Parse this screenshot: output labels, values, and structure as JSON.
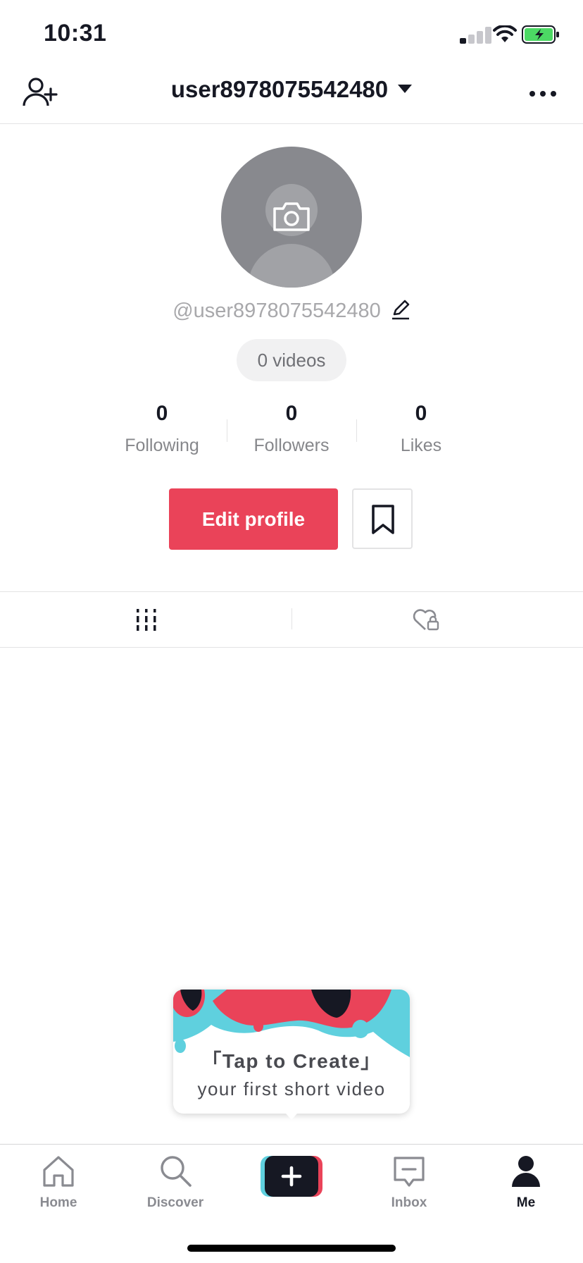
{
  "status_bar": {
    "time": "10:31"
  },
  "header": {
    "username": "user8978075542480"
  },
  "profile": {
    "handle": "@user8978075542480",
    "videos_label": "0 videos",
    "stats": [
      {
        "value": "0",
        "label": "Following"
      },
      {
        "value": "0",
        "label": "Followers"
      },
      {
        "value": "0",
        "label": "Likes"
      }
    ],
    "edit_label": "Edit profile"
  },
  "popup": {
    "title": "「Tap to Create」",
    "subtitle": "your first short video"
  },
  "nav": {
    "items": [
      {
        "label": "Home",
        "icon": "home-icon"
      },
      {
        "label": "Discover",
        "icon": "search-icon"
      },
      {
        "label": "",
        "icon": "plus-icon"
      },
      {
        "label": "Inbox",
        "icon": "inbox-icon"
      },
      {
        "label": "Me",
        "icon": "person-icon"
      }
    ]
  },
  "colors": {
    "accent": "#ea4359",
    "text": "#161823",
    "cyan": "#5fd0de",
    "battery_green": "#4cd964"
  }
}
